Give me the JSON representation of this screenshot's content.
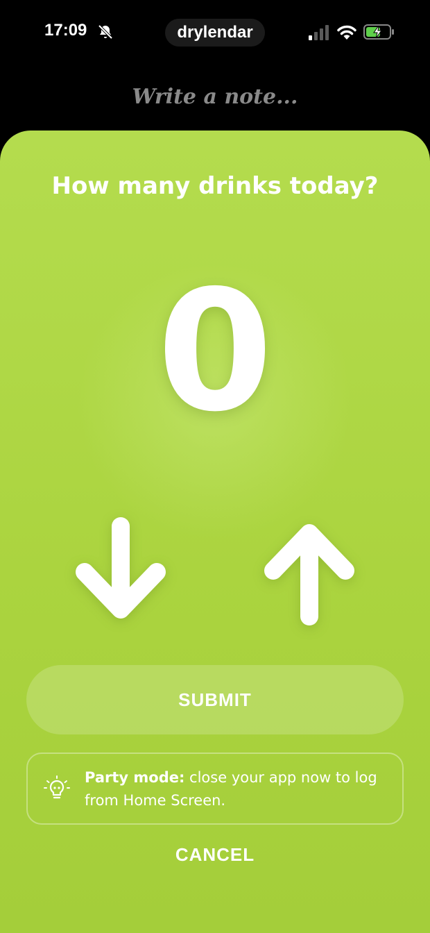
{
  "status_bar": {
    "time": "17:09",
    "app_name": "drylendar",
    "icons": [
      "bell-slash-icon",
      "signal-icon",
      "wifi-icon",
      "battery-charging-icon"
    ]
  },
  "note": {
    "placeholder": "Write a note..."
  },
  "sheet": {
    "question": "How many drinks today?",
    "count": "0",
    "decrement_icon": "arrow-down-icon",
    "increment_icon": "arrow-up-icon",
    "submit_label": "SUBMIT",
    "tip": {
      "icon": "lightbulb-icon",
      "bold": "Party mode:",
      "text": " close your app now to log from Home Screen."
    },
    "cancel_label": "CANCEL"
  },
  "colors": {
    "sheet_green": "#b4dc4e",
    "background": "#000000",
    "placeholder_gray": "#8a8a8a",
    "battery_green": "#5fd04b"
  }
}
